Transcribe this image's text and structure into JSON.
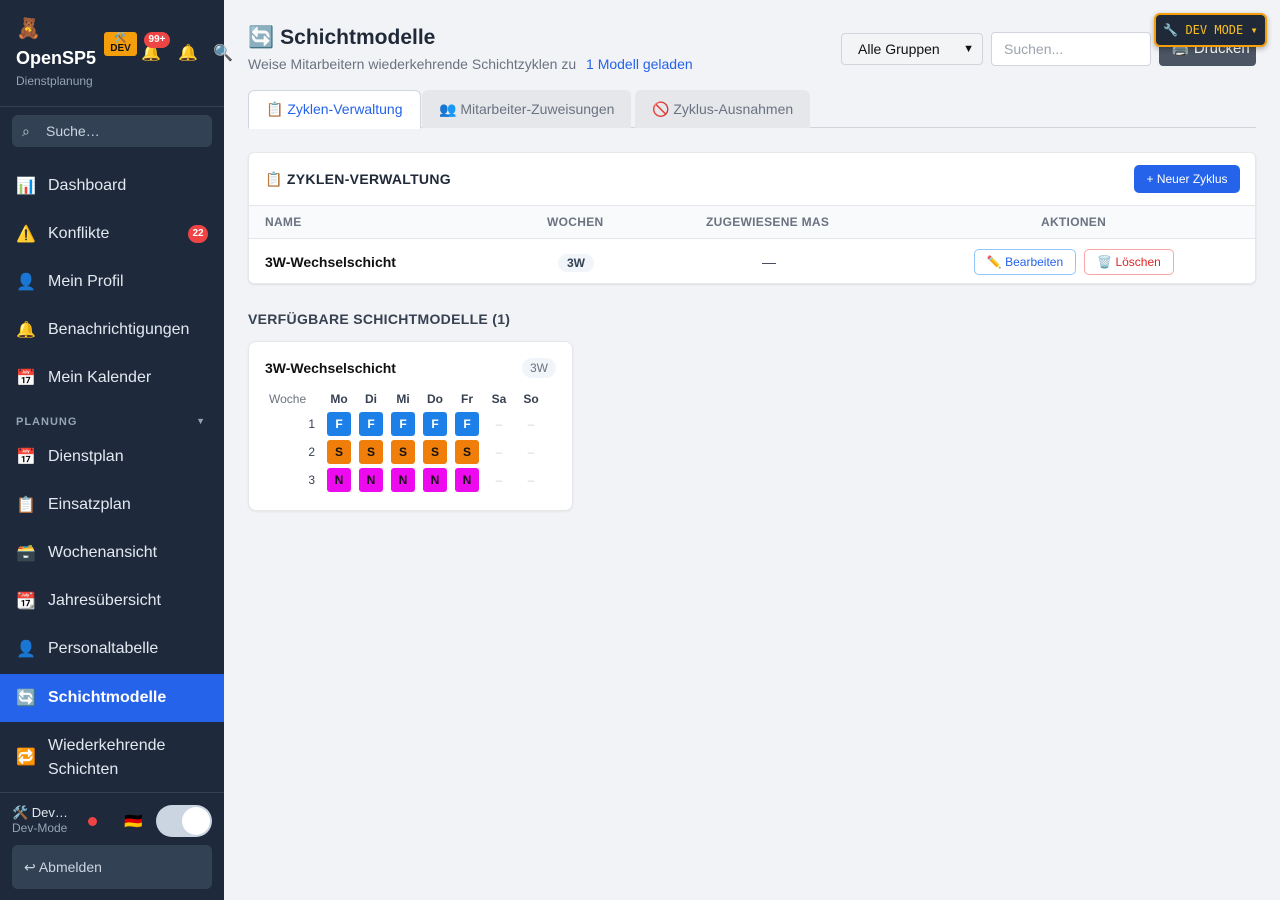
{
  "app": {
    "logo_icon": "🧸",
    "name": "OpenSP5",
    "subtitle": "Dienstplanung",
    "dev_tag": "🛠️ DEV",
    "notification_count": "99+"
  },
  "sidebar": {
    "search_placeholder": "Suche…",
    "items": [
      {
        "icon": "📊",
        "label": "Dashboard"
      },
      {
        "icon": "⚠️",
        "label": "Konflikte",
        "badge": "22"
      },
      {
        "icon": "👤",
        "label": "Mein Profil"
      },
      {
        "icon": "🔔",
        "label": "Benachrichtigungen"
      },
      {
        "icon": "📅",
        "label": "Mein Kalender"
      }
    ],
    "section_planung": "PLANUNG",
    "planung_items": [
      {
        "icon": "📅",
        "label": "Dienstplan"
      },
      {
        "icon": "📋",
        "label": "Einsatzplan"
      },
      {
        "icon": "🗃️",
        "label": "Wochenansicht"
      },
      {
        "icon": "📆",
        "label": "Jahresübersicht"
      },
      {
        "icon": "👤",
        "label": "Personaltabelle"
      },
      {
        "icon": "🔄",
        "label": "Schichtmodelle",
        "active": true
      },
      {
        "icon": "🔁",
        "label": "Wiederkehrende Schichten"
      }
    ],
    "footer": {
      "user_name": "🛠️ Dev…",
      "user_role": "Dev-Mode",
      "lang_flag": "🇩🇪",
      "logout_label": "↩ Abmelden"
    }
  },
  "header": {
    "title_icon": "🔄",
    "title": "Schichtmodelle",
    "subtitle": "Weise Mitarbeitern wiederkehrende Schichtzyklen zu",
    "subtitle_link": "1 Modell geladen",
    "group_select": "Alle Gruppen",
    "search_placeholder": "Suchen...",
    "print_label": "🖨️ Drucken",
    "dev_mode_label": "🔧 DEV MODE ▾"
  },
  "tabs": [
    {
      "label": "📋 Zyklen-Verwaltung",
      "active": true
    },
    {
      "label": "👥 Mitarbeiter-Zuweisungen"
    },
    {
      "label": "🚫 Zyklus-Ausnahmen"
    }
  ],
  "cycles_card": {
    "title": "📋 ZYKLEN-VERWALTUNG",
    "new_button": "+ Neuer Zyklus",
    "columns": [
      "NAME",
      "WOCHEN",
      "ZUGEWIESENE MAS",
      "AKTIONEN"
    ],
    "rows": [
      {
        "name": "3W-Wechselschicht",
        "weeks": "3W",
        "assigned": "—",
        "edit": "✏️ Bearbeiten",
        "delete": "🗑️ Löschen"
      }
    ]
  },
  "available": {
    "title": "VERFÜGBARE SCHICHTMODELLE (1)",
    "models": [
      {
        "name": "3W-Wechselschicht",
        "weeks": "3W",
        "week_label": "Woche",
        "days": [
          "Mo",
          "Di",
          "Mi",
          "Do",
          "Fr",
          "Sa",
          "So"
        ],
        "rows": [
          {
            "week": "1",
            "shifts": [
              "F",
              "F",
              "F",
              "F",
              "F",
              "–",
              "–"
            ]
          },
          {
            "week": "2",
            "shifts": [
              "S",
              "S",
              "S",
              "S",
              "S",
              "–",
              "–"
            ]
          },
          {
            "week": "3",
            "shifts": [
              "N",
              "N",
              "N",
              "N",
              "N",
              "–",
              "–"
            ]
          }
        ]
      }
    ]
  },
  "colors": {
    "accent": "#2563eb",
    "sidebar_bg": "#1e293b",
    "shift_F": "#1d7fe8",
    "shift_S": "#f07e0b",
    "shift_N": "#ee0aee",
    "dev_border": "#f59e0b"
  }
}
